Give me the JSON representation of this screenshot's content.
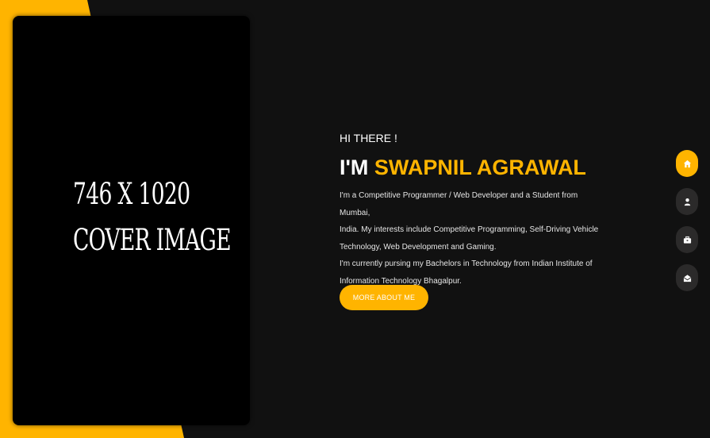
{
  "colors": {
    "accent": "#ffb400",
    "background": "#111111",
    "nav_bubble": "#2b2a2a"
  },
  "cover": {
    "line1": "746 X 1020",
    "line2": "COVER IMAGE"
  },
  "hero": {
    "greeting": "HI THERE !",
    "headline_prefix": "I'M ",
    "name": "SWAPNIL AGRAWAL",
    "bio_line1": "I'm a Competitive Programmer / Web Developer and a Student from Mumbai,",
    "bio_line2": "India. My interests include Competitive Programming, Self-Driving Vehicle",
    "bio_line3": "Technology, Web Development and Gaming.",
    "bio_line4": "I'm currently pursing my Bachelors in Technology from Indian Institute of",
    "bio_line5": "Information Technology Bhagalpur.",
    "button_label": "MORE ABOUT ME"
  },
  "nav": [
    {
      "icon": "home-icon",
      "active": true
    },
    {
      "icon": "user-icon",
      "active": false
    },
    {
      "icon": "briefcase-icon",
      "active": false
    },
    {
      "icon": "envelope-icon",
      "active": false
    }
  ]
}
